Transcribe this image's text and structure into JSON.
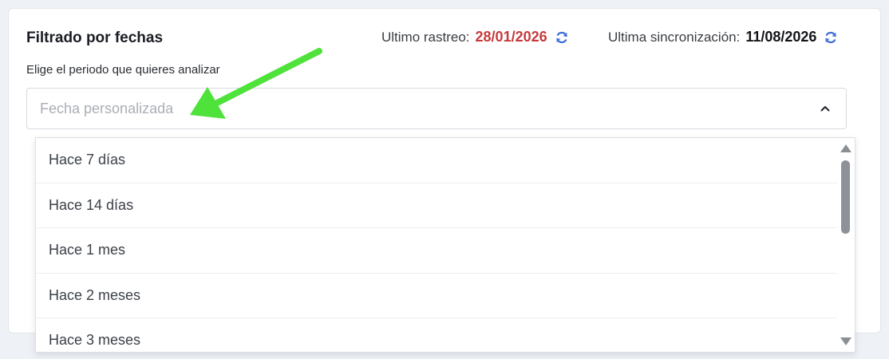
{
  "colors": {
    "accent_red": "#c8393b",
    "accent_dark": "#121418",
    "refresh_blue": "#3f6fd8",
    "annotation_green": "#4fe23a"
  },
  "filter": {
    "title": "Filtrado por fechas",
    "subtitle": "Elige el periodo que quieres analizar"
  },
  "status": {
    "last_crawl_label": "Ultimo rastreo:",
    "last_crawl_value": "28/01/2026",
    "last_sync_label": "Ultima sincronización:",
    "last_sync_value": "11/08/2026",
    "refresh_icon": "refresh-icon"
  },
  "select": {
    "placeholder": "Fecha personalizada",
    "chevron_icon": "chevron-up-icon"
  },
  "dropdown": {
    "options": [
      {
        "label": "Hace 7 días"
      },
      {
        "label": "Hace 14 días"
      },
      {
        "label": "Hace 1 mes"
      },
      {
        "label": "Hace 2 meses"
      },
      {
        "label": "Hace 3 meses"
      }
    ]
  }
}
